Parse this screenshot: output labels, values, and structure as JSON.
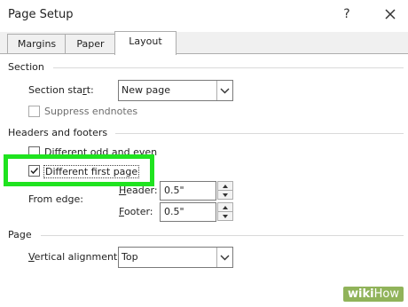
{
  "window": {
    "title": "Page Setup",
    "help_label": "?"
  },
  "tabs": [
    {
      "label": "Margins",
      "active": false
    },
    {
      "label": "Paper",
      "active": false
    },
    {
      "label": "Layout",
      "active": true
    }
  ],
  "section": {
    "heading": "Section",
    "start_label": "Section start:",
    "start_value": "New page",
    "suppress_endnotes_label": "Suppress endnotes",
    "suppress_endnotes_checked": false
  },
  "headers_footers": {
    "heading": "Headers and footers",
    "odd_even_label": "Different odd and even",
    "odd_even_checked": false,
    "first_page_label": "Different first page",
    "first_page_checked": true,
    "from_edge_label": "From edge:",
    "header_label": "Header:",
    "header_value": "0.5\"",
    "footer_label": "Footer:",
    "footer_value": "0.5\""
  },
  "page": {
    "heading": "Page",
    "vertical_alignment_label": "Vertical alignment:",
    "vertical_alignment_value": "Top"
  },
  "watermark": {
    "wiki": "wiki",
    "how": "How"
  },
  "colors": {
    "highlight": "#1fe31f",
    "watermark_bg": "#90b35a"
  }
}
